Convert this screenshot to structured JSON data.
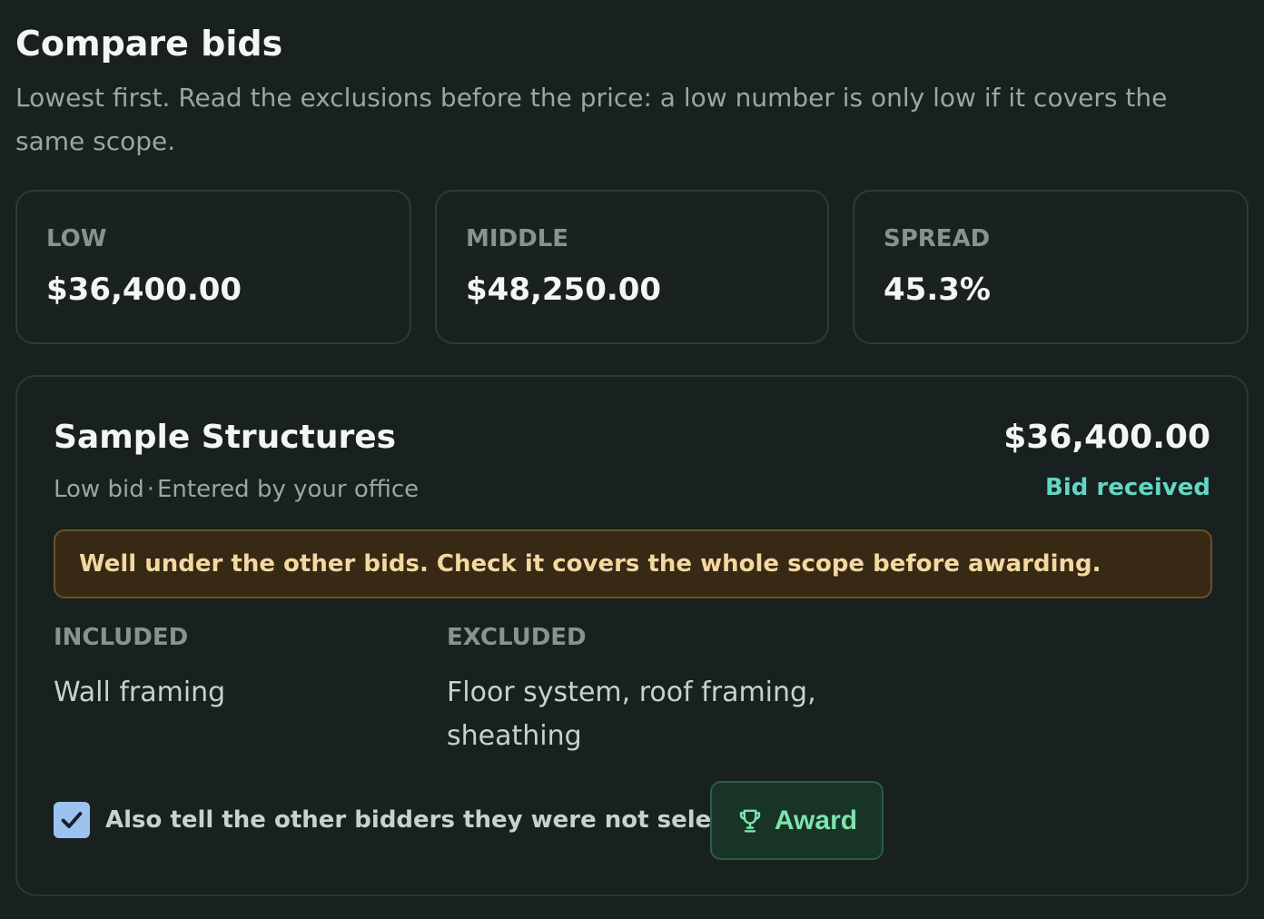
{
  "header": {
    "title": "Compare bids",
    "subtitle": "Lowest first. Read the exclusions before the price: a low number is only low if it covers the same scope."
  },
  "stats": {
    "low": {
      "label": "LOW",
      "value": "$36,400.00"
    },
    "middle": {
      "label": "MIDDLE",
      "value": "$48,250.00"
    },
    "spread": {
      "label": "SPREAD",
      "value": "45.3%"
    }
  },
  "bid": {
    "bidder": "Sample Structures",
    "rank": "Low bid",
    "separator": "·",
    "source": "Entered by your office",
    "amount": "$36,400.00",
    "status": "Bid received",
    "warning": "Well under the other bids. Check it covers the whole scope before awarding.",
    "included": {
      "heading": "INCLUDED",
      "text": "Wall framing"
    },
    "excluded": {
      "heading": "EXCLUDED",
      "text": "Floor system, roof framing, sheathing"
    },
    "notify": {
      "checked": true,
      "label": "Also tell the other bidders they were not selected"
    },
    "award_button": {
      "label": "Award",
      "icon": "trophy-icon"
    }
  },
  "colors": {
    "background": "#182020",
    "status": "#63d6c5",
    "warning_bg": "#372913",
    "warning_text": "#f4d8a2",
    "award_text": "#7fe3ad",
    "checkbox": "#9cc3ef"
  }
}
